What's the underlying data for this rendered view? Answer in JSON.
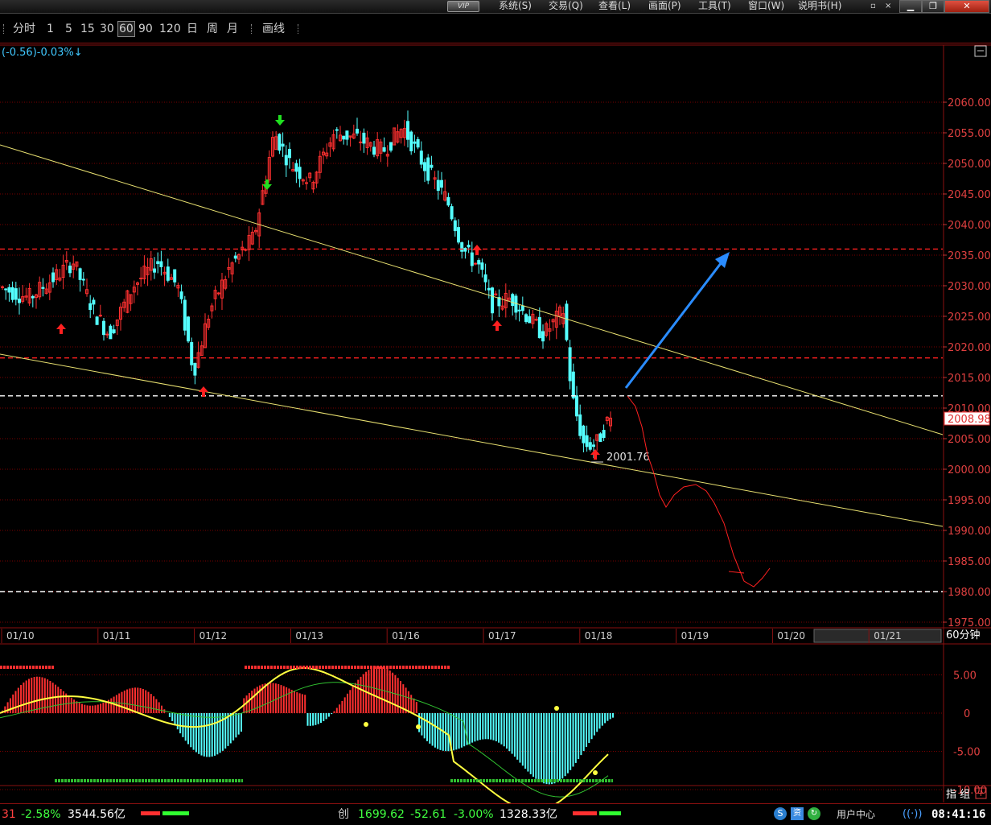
{
  "menubar": {
    "vip": "VIP",
    "items": [
      "系统(S)",
      "交易(Q)",
      "查看(L)",
      "画面(P)",
      "工具(T)",
      "窗口(W)",
      "说明书(H)"
    ]
  },
  "toolbar": {
    "items": [
      "分时",
      "1",
      "5",
      "15",
      "30",
      "60",
      "90",
      "120",
      "日",
      "周",
      "月"
    ],
    "selected": "60",
    "draw": "画线"
  },
  "quote": {
    "change": "(-0.56)-0.03%↓"
  },
  "main_chart": {
    "price_axis": [
      "2060.00",
      "2055.00",
      "2050.00",
      "2045.00",
      "2040.00",
      "2035.00",
      "2030.00",
      "2025.00",
      "2020.00",
      "2015.00",
      "2010.00",
      "2005.00",
      "2000.00",
      "1995.00",
      "1990.00",
      "1985.00",
      "1980.00",
      "1975.00"
    ],
    "last_price": "2008.98",
    "low_label": "2001.76",
    "dates": [
      "01/10",
      "01/11",
      "01/12",
      "01/13",
      "01/16",
      "01/17",
      "01/18",
      "01/19",
      "01/20",
      "01/21"
    ],
    "period_label": "60分钟"
  },
  "indicator": {
    "axis": [
      "5.00",
      "0",
      "-5.00",
      "-10.00"
    ],
    "label": "指 组"
  },
  "statusbar": {
    "idx1_tail": "31",
    "idx1_pct": "-2.58%",
    "idx1_amount": "3544.56亿",
    "idx2_name": "创",
    "idx2_value": "1699.62",
    "idx2_change": "-52.61",
    "idx2_pct": "-3.00%",
    "idx2_amount": "1328.33亿",
    "user_center": "用户中心",
    "time": "08:41:16"
  },
  "colors": {
    "up": "#ff3030",
    "down": "#54ffff",
    "grid": "#7a0000",
    "trend": "#e8e070",
    "arrow": "#2a8cff"
  }
}
